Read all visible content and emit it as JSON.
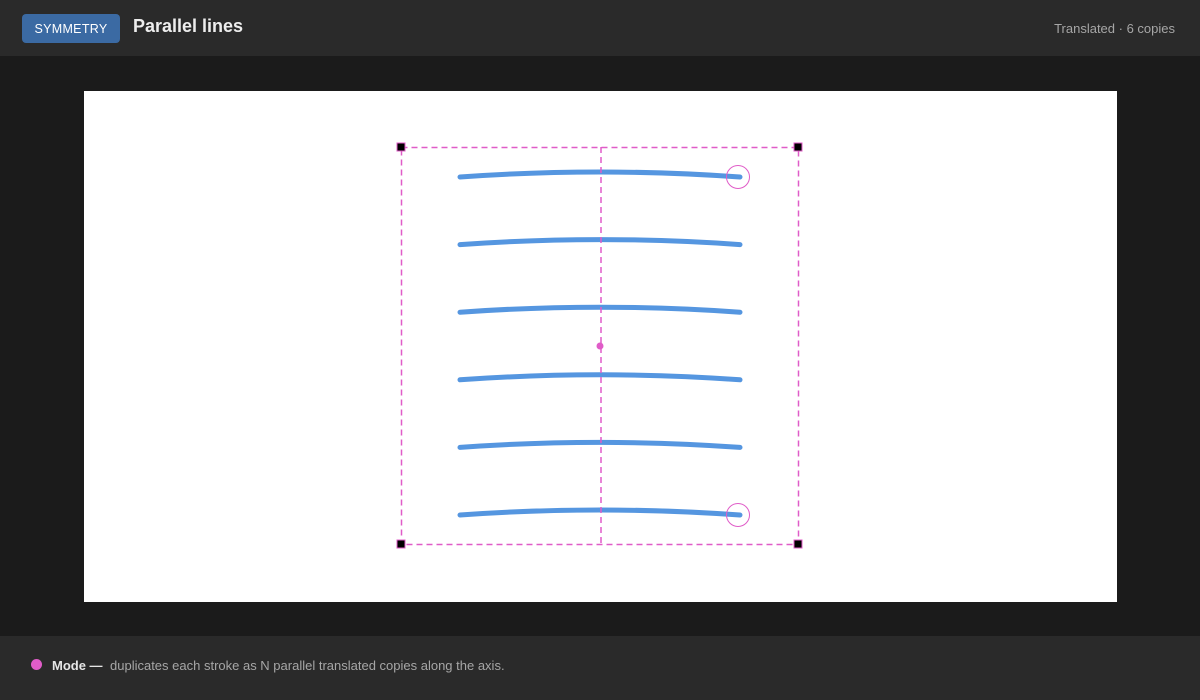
{
  "header": {
    "badge_label": "SYMMETRY",
    "title": "Parallel lines",
    "status": "Translated · 6 copies"
  },
  "symmetry": {
    "mode": "translate",
    "copies": 6
  },
  "colors": {
    "stroke": "#5596e0",
    "guide": "#e05cc8",
    "handle": "#000000",
    "badge": "#3b6aa3"
  },
  "footer": {
    "mode_label": "Mode —",
    "mode_description": "duplicates each stroke as N parallel translated copies along the axis."
  }
}
